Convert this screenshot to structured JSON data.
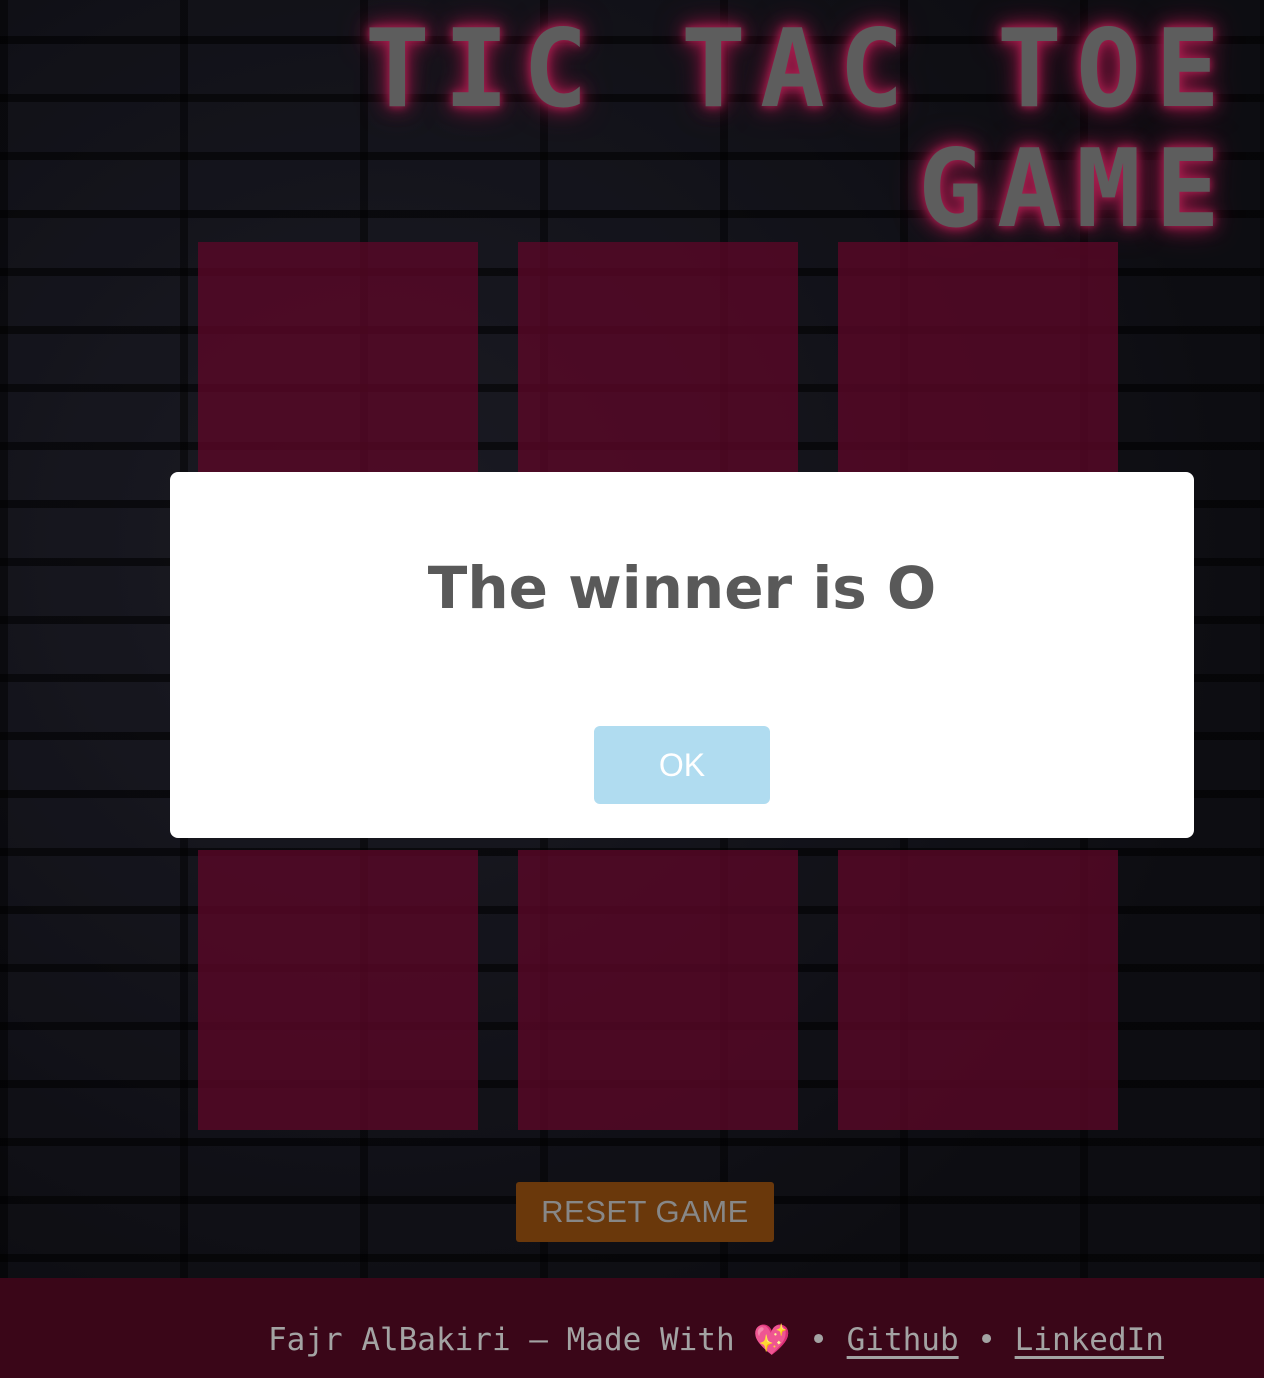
{
  "header": {
    "title": "TIC TAC TOE GAME"
  },
  "board": {
    "cells": [
      "",
      "",
      "",
      "",
      "",
      "",
      "",
      "",
      ""
    ]
  },
  "controls": {
    "reset_label": "RESET GAME"
  },
  "modal": {
    "message": "The winner is O",
    "ok_label": "OK"
  },
  "footer": {
    "author": "Fajr AlBakiri",
    "made_with": " – Made With ",
    "heart_icon": "💖",
    "separator": " • ",
    "github_label": "Github",
    "linkedin_label": "LinkedIn"
  },
  "colors": {
    "cell": "#8c0c3c",
    "reset_button": "#a35712",
    "footer": "#5a0a26",
    "ok_button": "#b0dcf0",
    "title_glow": "#ff2f78"
  }
}
